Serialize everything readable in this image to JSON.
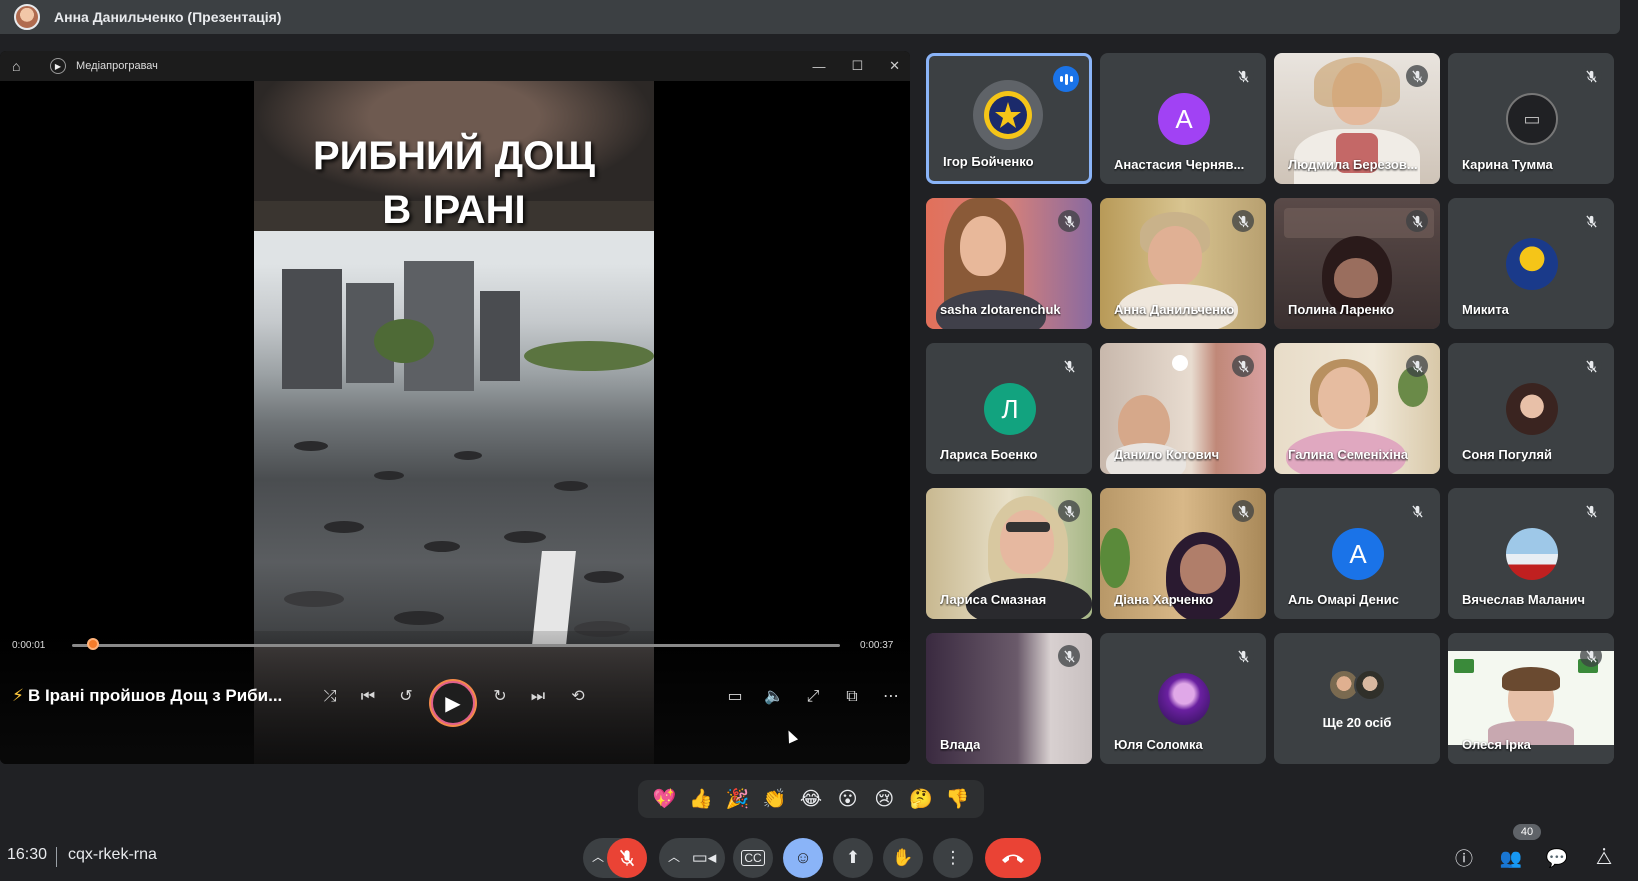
{
  "presenter": {
    "name": "Анна Данильченко (Презентація)"
  },
  "player": {
    "app_title": "Медіапрогравач",
    "headline_line1": "РИБНИЙ ДОЩ",
    "headline_line2": "В ІРАНІ",
    "time_current": "0:00:01",
    "time_total": "0:00:37",
    "progress_fraction": 0.027,
    "track_title": "В Ірані пройшов Дощ з Риби..."
  },
  "participants": [
    {
      "name": "Ігор Бойченко",
      "speaking": true
    },
    {
      "name": "Анастасия Черняв...",
      "initial": "А",
      "color": "#a142f4"
    },
    {
      "name": "Людмила Березов..."
    },
    {
      "name": "Карина Тумма"
    },
    {
      "name": "sasha zlotarenchuk"
    },
    {
      "name": "Анна Данильченко"
    },
    {
      "name": "Полина Ларенко"
    },
    {
      "name": "Микита"
    },
    {
      "name": "Лариса Боенко",
      "initial": "Л",
      "color": "#12a37f"
    },
    {
      "name": "Данило Котович"
    },
    {
      "name": "Галина Семеніхіна"
    },
    {
      "name": "Соня Погуляй"
    },
    {
      "name": "Лариса Смазная"
    },
    {
      "name": "Діана Харченко"
    },
    {
      "name": "Аль Омарі Денис",
      "initial": "А",
      "color": "#1a73e8"
    },
    {
      "name": "Вячеслав Маланич"
    },
    {
      "name": "Влада"
    },
    {
      "name": "Юля Соломка"
    },
    {
      "name": "Ще 20 осіб"
    },
    {
      "name": "Олеся Ірка"
    }
  ],
  "reactions": [
    "💖",
    "👍",
    "🎉",
    "👏",
    "😂",
    "😮",
    "😢",
    "🤔",
    "👎"
  ],
  "bottom": {
    "clock": "16:30",
    "meeting_code": "cqx-rkek-rna",
    "people_count": "40"
  },
  "colors": {
    "accent": "#8ab4f8",
    "danger": "#ea4335",
    "panel": "#3c4043",
    "background": "#202124"
  }
}
